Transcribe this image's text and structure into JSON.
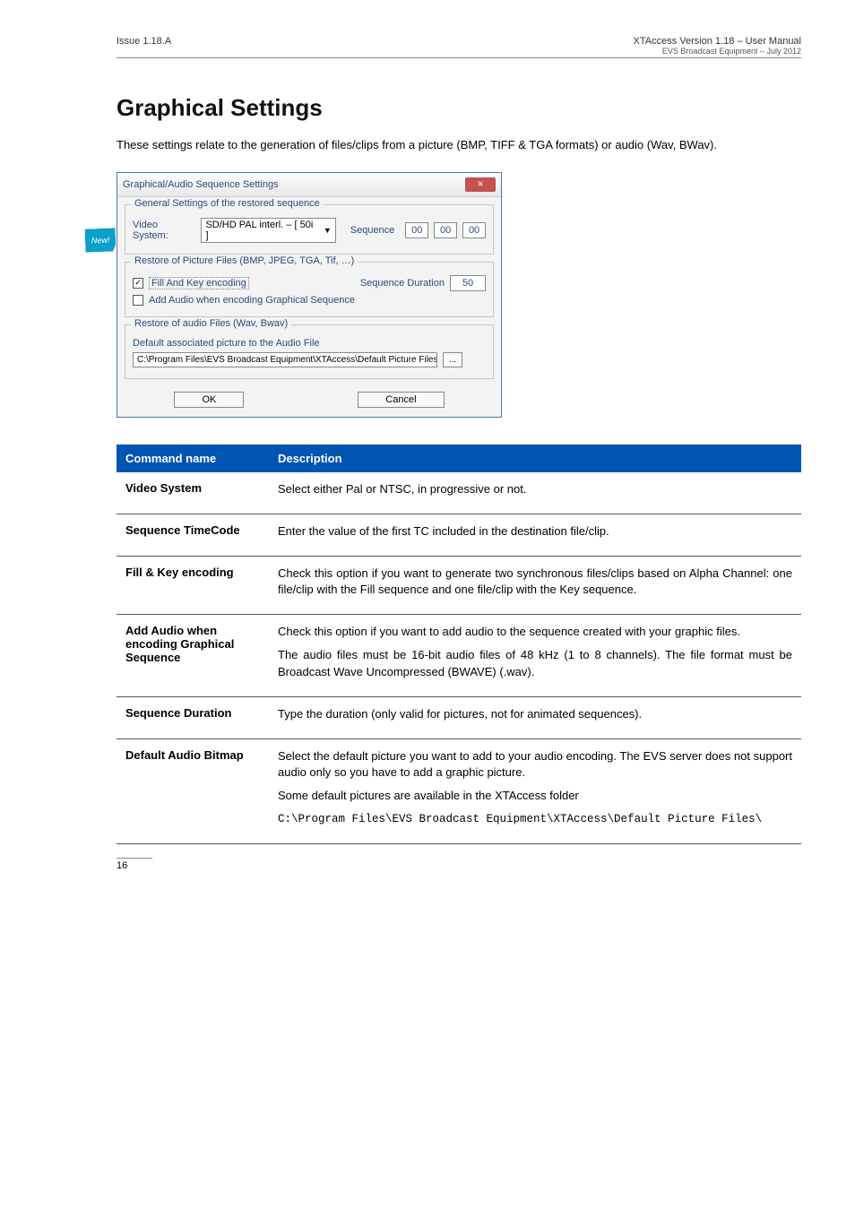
{
  "header": {
    "left": "Issue 1.18.A",
    "right_line1": "XTAccess  Version 1.18 – User Manual",
    "right_line2": "EVS Broadcast Equipment – July  2012"
  },
  "new_badge": "New!",
  "section_title": "Graphical Settings",
  "intro": "These settings relate to the generation of files/clips from a picture (BMP, TIFF & TGA formats) or audio (Wav, BWav).",
  "dialog": {
    "title": "Graphical/Audio Sequence Settings",
    "close": "×",
    "group1": {
      "legend": "General Settings of the restored sequence",
      "vs_label": "Video System:",
      "vs_value": "SD/HD PAL interl. – [ 50i ]",
      "seq_label": "Sequence",
      "tc1": "00",
      "tc2": "00",
      "tc3": "00"
    },
    "group2": {
      "legend": "Restore of Picture Files (BMP, JPEG, TGA, Tif, …)",
      "chk1": "Fill And Key encoding",
      "sd_label": "Sequence Duration",
      "sd_value": "50",
      "chk2": "Add Audio when encoding Graphical Sequence"
    },
    "group3": {
      "legend": "Restore of audio Files (Wav, Bwav)",
      "sub": "Default associated picture to the Audio File",
      "path": "C:\\Program Files\\EVS Broadcast Equipment\\XTAccess\\Default Picture Files\\|",
      "browse": "..."
    },
    "ok": "OK",
    "cancel": "Cancel"
  },
  "table": {
    "head_cmd": "Command name",
    "head_desc": "Description",
    "rows": [
      {
        "name": "Video System",
        "desc": [
          "Select either Pal or NTSC, in progressive or not."
        ]
      },
      {
        "name": "Sequence TimeCode",
        "desc": [
          "Enter the value of the first TC included in the destination file/clip."
        ]
      },
      {
        "name": "Fill & Key encoding",
        "desc": [
          "Check this option if you want to generate two synchronous files/clips based on Alpha Channel: one file/clip with the Fill sequence and one file/clip with the Key sequence."
        ]
      },
      {
        "name": "Add Audio when encoding Graphical Sequence",
        "desc": [
          "Check this option if you want to add audio to the sequence created with your graphic files.",
          "The audio files must be 16-bit audio files of 48 kHz (1 to 8 channels). The file format must be Broadcast Wave Uncompressed (BWAVE) (.wav)."
        ]
      },
      {
        "name": "Sequence Duration",
        "desc": [
          "Type the duration (only valid for pictures, not for animated sequences)."
        ]
      },
      {
        "name": "Default Audio Bitmap",
        "desc": [
          "Select the default picture you want to add to your audio encoding. The EVS server does not support audio only so you have to add a graphic picture.",
          "Some default pictures are available in the XTAccess folder"
        ],
        "path": "C:\\Program Files\\EVS Broadcast Equipment\\XTAccess\\Default Picture Files\\"
      }
    ]
  },
  "page_number": "16"
}
